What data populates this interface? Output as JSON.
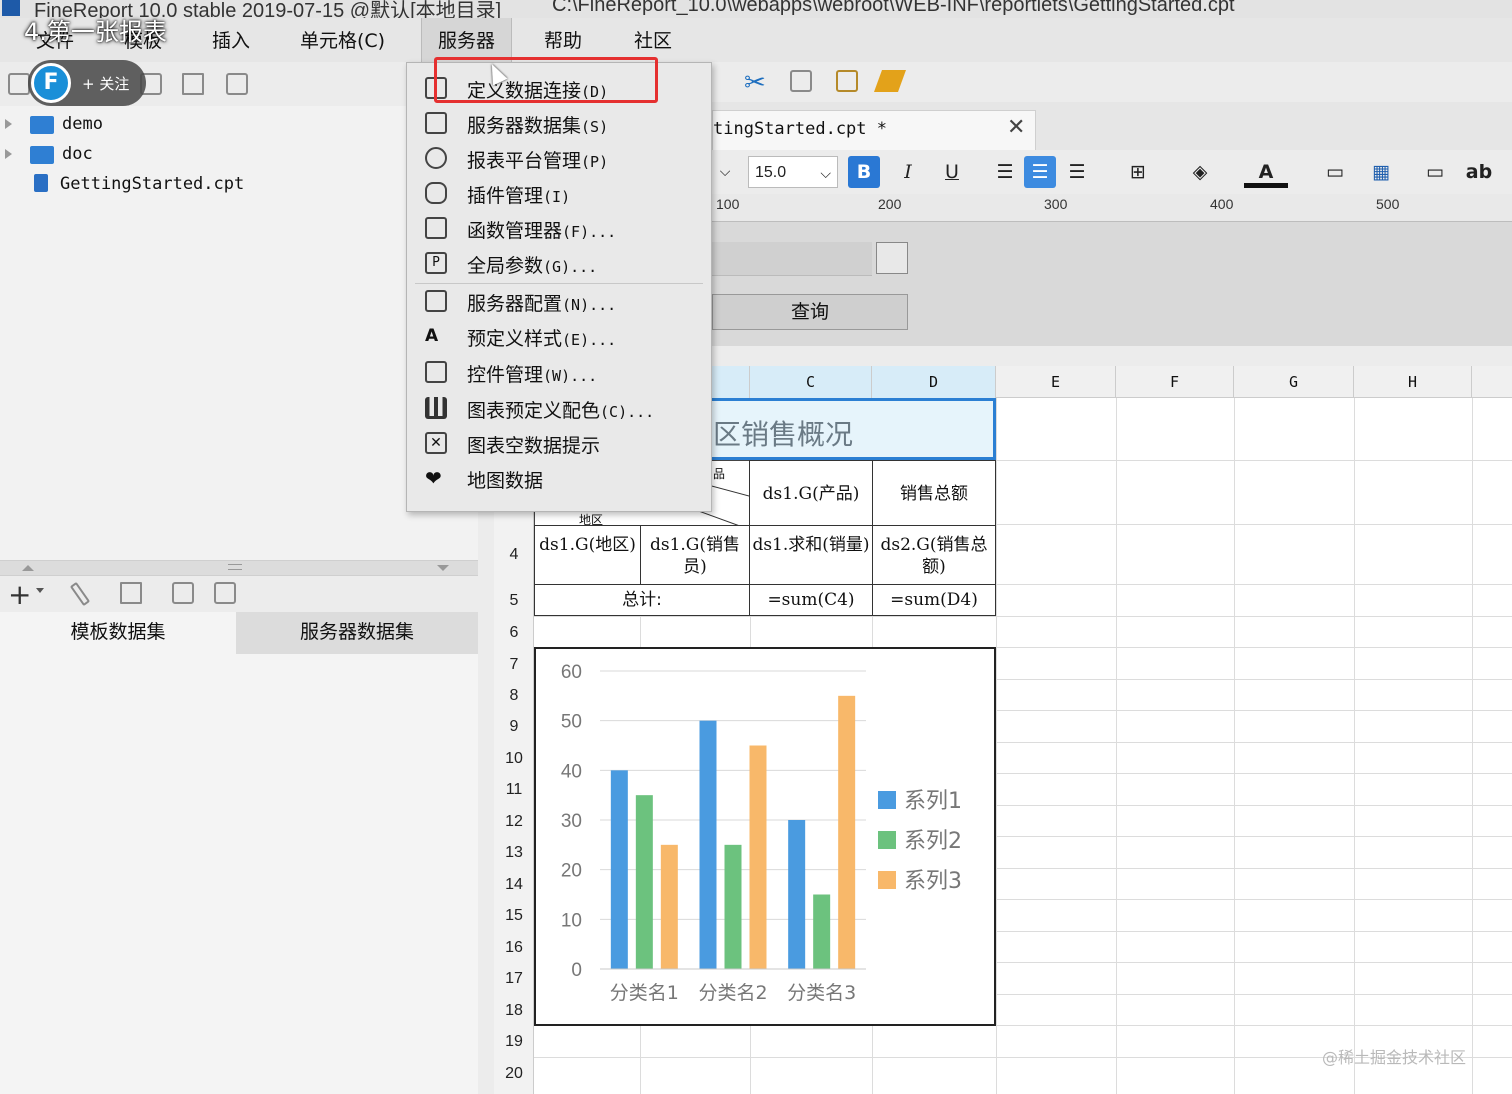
{
  "window": {
    "title": "FineReport 10.0 stable 2019-07-15 @默认[本地目录]",
    "path": "C:\\FineReport_10.0\\webapps\\webroot\\WEB-INF\\reportlets\\GettingStarted.cpt"
  },
  "overlay": {
    "video_title": "4.第一张报表",
    "follow_label": "+ 关注"
  },
  "menubar": {
    "file": "文件",
    "template": "模板",
    "insert": "插入",
    "cell": "单元格(C)",
    "server": "服务器",
    "help": "帮助",
    "community": "社区"
  },
  "server_menu": {
    "items": [
      {
        "label": "定义数据连接",
        "accel": "(D)",
        "icon": "data-connection-icon"
      },
      {
        "label": "服务器数据集",
        "accel": "(S)",
        "icon": "server-dataset-icon"
      },
      {
        "label": "报表平台管理",
        "accel": "(P)",
        "icon": "platform-user-icon"
      },
      {
        "label": "插件管理",
        "accel": "(I)",
        "icon": "plugin-icon"
      },
      {
        "label": "函数管理器",
        "accel": "(F)...",
        "icon": "function-manager-icon"
      },
      {
        "label": "全局参数",
        "accel": "(G)...",
        "icon": "global-param-icon"
      },
      {
        "label": "服务器配置",
        "accel": "(N)...",
        "icon": "server-config-icon"
      },
      {
        "label": "预定义样式",
        "accel": "(E)...",
        "icon": "predefined-style-icon"
      },
      {
        "label": "控件管理",
        "accel": "(W)...",
        "icon": "widget-manager-icon"
      },
      {
        "label": "图表预定义配色",
        "accel": "(C)...",
        "icon": "chart-color-icon"
      },
      {
        "label": "图表空数据提示",
        "accel": "",
        "icon": "chart-empty-icon"
      },
      {
        "label": "地图数据",
        "accel": "",
        "icon": "map-data-icon"
      }
    ]
  },
  "tree": {
    "items": [
      {
        "label": "demo",
        "type": "folder"
      },
      {
        "label": "doc",
        "type": "folder"
      },
      {
        "label": "GettingStarted.cpt",
        "type": "file"
      }
    ]
  },
  "datasets": {
    "tab_template": "模板数据集",
    "tab_server": "服务器数据集"
  },
  "doc_tab": {
    "name": "tingStarted.cpt *",
    "close": "✕"
  },
  "format": {
    "font_size": "15.0",
    "bold": "B",
    "italic": "I",
    "underline": "U",
    "text_color": "A",
    "wrap": "ab"
  },
  "ruler": {
    "labels": [
      "100",
      "200",
      "300",
      "400",
      "500"
    ]
  },
  "param_panel": {
    "query_label": "查询"
  },
  "grid": {
    "columns": [
      "C",
      "D",
      "E",
      "F",
      "G",
      "H"
    ],
    "rows": [
      "4",
      "5",
      "6",
      "7",
      "8",
      "9",
      "10",
      "11",
      "12",
      "13",
      "14",
      "15",
      "16",
      "17",
      "18",
      "19",
      "20"
    ],
    "title_text": "区销售概况",
    "cells": {
      "c3": "ds1.G(产品)",
      "d3": "销售总额",
      "a4": "ds1.G(地区)",
      "b4": "ds1.G(销售员)",
      "c4": "ds1.求和(销量)",
      "d4": "ds2.G(销售总额)",
      "a5": "总计:",
      "c5": "=sum(C4)",
      "d5": "=sum(D4)"
    },
    "fragments": {
      "area": "地区",
      "product": "品"
    }
  },
  "chart_data": {
    "type": "bar",
    "categories": [
      "分类名1",
      "分类名2",
      "分类名3"
    ],
    "series": [
      {
        "name": "系列1",
        "values": [
          40,
          50,
          30
        ],
        "color": "#4a9be0"
      },
      {
        "name": "系列2",
        "values": [
          35,
          25,
          15
        ],
        "color": "#6cc27e"
      },
      {
        "name": "系列3",
        "values": [
          25,
          45,
          55
        ],
        "color": "#f8b86a"
      }
    ],
    "ylim": [
      0,
      60
    ],
    "yticks": [
      "0",
      "10",
      "20",
      "30",
      "40",
      "50",
      "60"
    ],
    "grid": true,
    "legend": "right"
  },
  "watermark": "@稀土掘金技术社区",
  "colors": {
    "highlight": "#e53030",
    "selection": "#2b7fd3"
  }
}
